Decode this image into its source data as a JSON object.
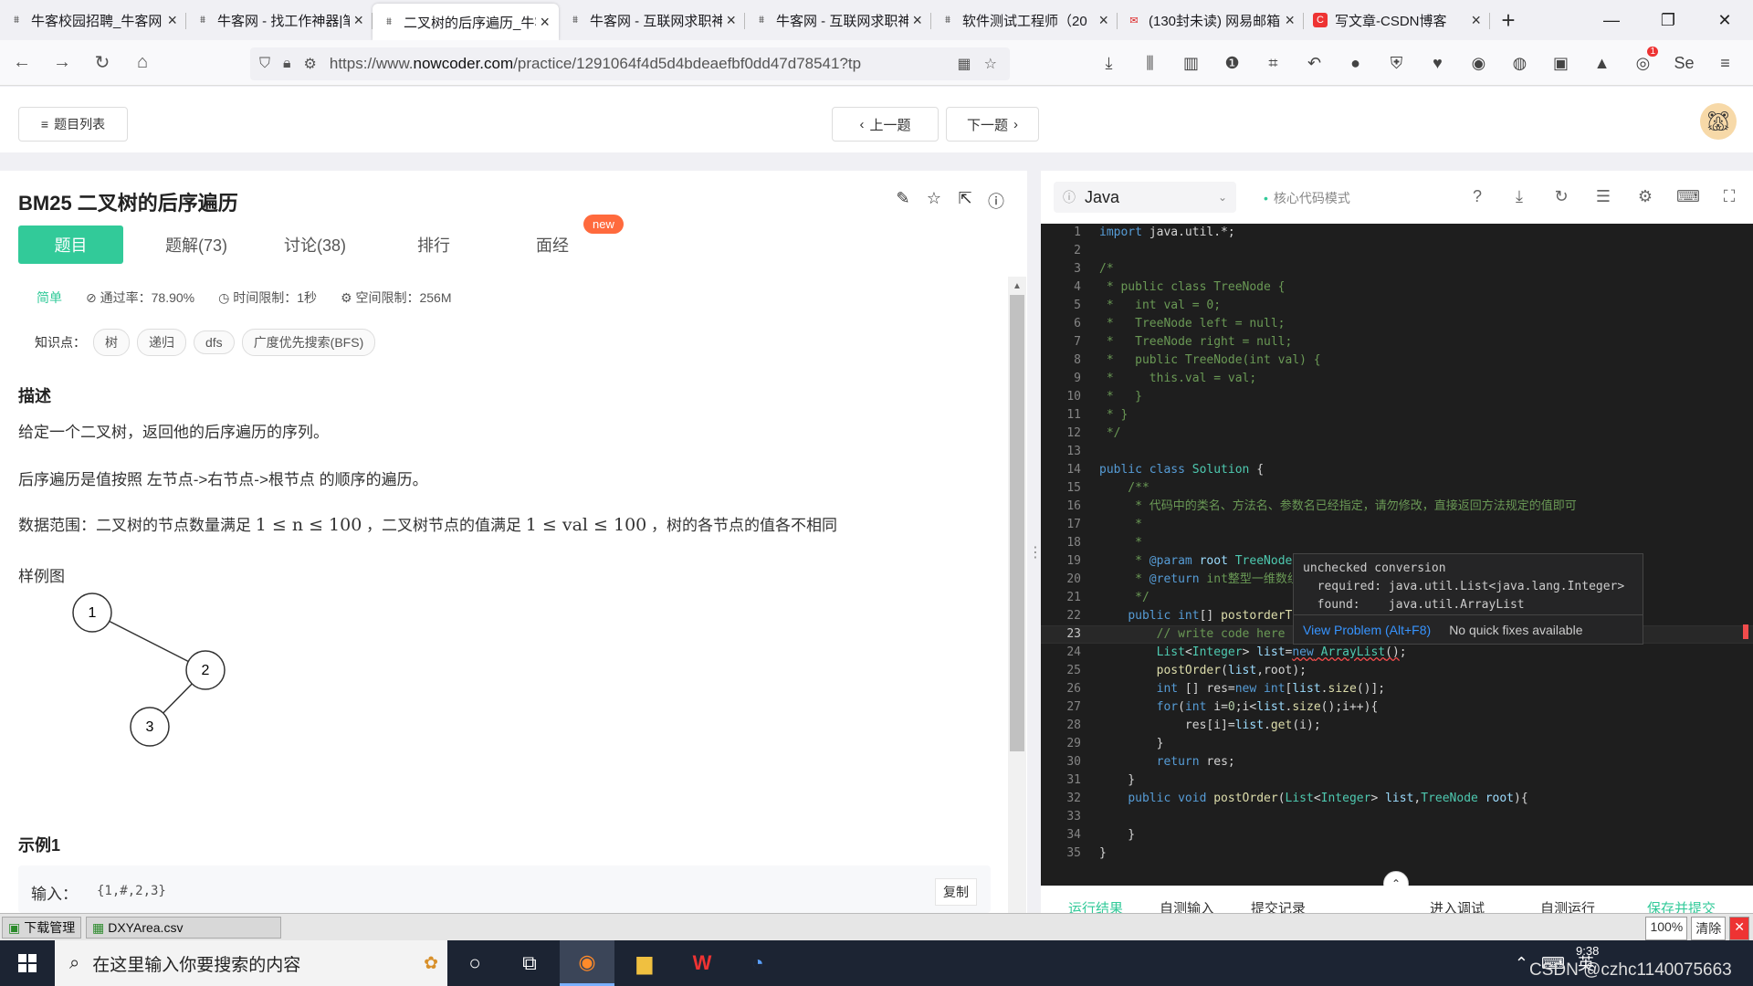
{
  "browser": {
    "tabs": [
      {
        "title": "牛客校园招聘_牛客网",
        "favicon": "nowcoder"
      },
      {
        "title": "牛客网 - 找工作神器|笔",
        "favicon": "nowcoder"
      },
      {
        "title": "二叉树的后序遍历_牛客",
        "favicon": "nowcoder",
        "active": true
      },
      {
        "title": "牛客网 - 互联网求职神",
        "favicon": "nowcoder"
      },
      {
        "title": "牛客网 - 互联网求职神",
        "favicon": "nowcoder"
      },
      {
        "title": "软件测试工程师（20",
        "favicon": "nowcoder"
      },
      {
        "title": "(130封未读) 网易邮箱",
        "favicon": "netease"
      },
      {
        "title": "写文章-CSDN博客",
        "favicon": "csdn"
      }
    ],
    "url_prefix": "https://www.",
    "url_host": "nowcoder.com",
    "url_rest": "/practice/1291064f4d5d4bdeaefbf0dd47d78541?tp",
    "notification_count": "1"
  },
  "page": {
    "list_button": "题目列表",
    "prev_button": "上一题",
    "next_button": "下一题",
    "problem_title": "BM25  二叉树的后序遍历",
    "tabs": [
      "题目",
      "题解(73)",
      "讨论(38)",
      "排行",
      "面经"
    ],
    "new_badge": "new",
    "difficulty": "简单",
    "pass_rate": "通过率：78.90%",
    "time_limit": "时间限制：1秒",
    "space_limit": "空间限制：256M",
    "knowledge_label": "知识点：",
    "knowledge_tags": [
      "树",
      "递归",
      "dfs",
      "广度优先搜索(BFS)"
    ],
    "desc_heading": "描述",
    "desc_line1": "给定一个二叉树，返回他的后序遍历的序列。",
    "desc_line2": "后序遍历是值按照 左节点->右节点->根节点 的顺序的遍历。",
    "range_prefix": "数据范围：二叉树的节点数量满足 ",
    "range_math1": "1 ≤ n ≤ 100",
    "range_mid": " ，二叉树节点的值满足 ",
    "range_math2": "1 ≤ val ≤ 100",
    "range_suffix": " ，树的各节点的值各不相同",
    "sample_label": "样例图",
    "tree_nodes": [
      "1",
      "2",
      "3"
    ],
    "example_heading": "示例1",
    "input_label": "输入：",
    "input_value": "{1,#,2,3}",
    "copy_button": "复制"
  },
  "editor": {
    "language": "Java",
    "mode": "核心代码模式",
    "current_line": 23,
    "hover": {
      "message": "unchecked conversion\n  required: java.util.List<java.lang.Integer>\n  found:    java.util.ArrayList",
      "link": "View Problem (Alt+F8)",
      "note": "No quick fixes available"
    },
    "footer_tabs": [
      "运行结果",
      "自测输入",
      "提交记录",
      "进入调试",
      "自测运行",
      "保存并提交"
    ]
  },
  "downloads": {
    "manager": "下载管理",
    "file": "DXYArea.csv",
    "zoom": "100%",
    "clear": "清除"
  },
  "taskbar": {
    "search_placeholder": "在这里输入你要搜索的内容",
    "ime": "英",
    "time": "9:38",
    "watermark": "CSDN @czhc1140075663"
  }
}
